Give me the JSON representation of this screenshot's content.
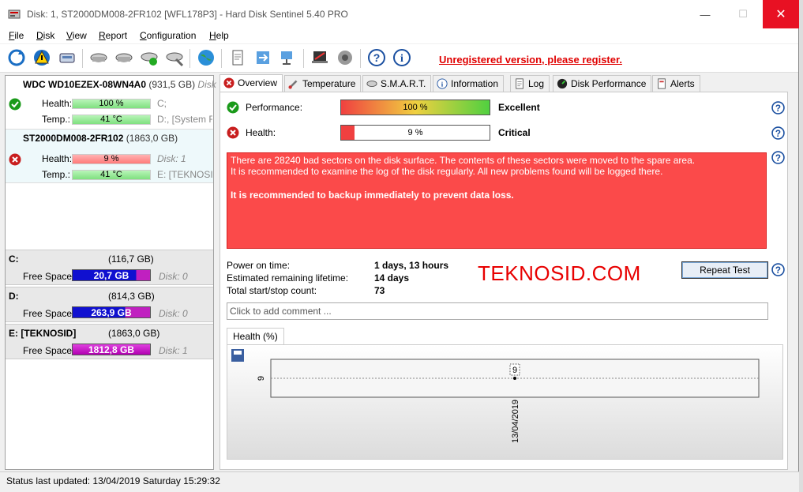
{
  "titlebar": {
    "title": "Disk: 1, ST2000DM008-2FR102 [WFL178P3]  -  Hard Disk Sentinel 5.40 PRO",
    "minimize": "—",
    "maximize": "☐",
    "close": "✕"
  },
  "menu": [
    "File",
    "Disk",
    "View",
    "Report",
    "Configuration",
    "Help"
  ],
  "toolbar": {
    "unregistered": "Unregistered version, please register."
  },
  "disks": [
    {
      "name": "WDC WD10EZEX-08WN4A0",
      "size": "(931,5 GB)",
      "extra": "Disk",
      "health_label": "Health:",
      "health": "100 %",
      "health_drives": "C;",
      "temp_label": "Temp.:",
      "temp": "41 °C",
      "temp_drives": "D:, [System R"
    },
    {
      "name": "ST2000DM008-2FR102",
      "size": "(1863,0 GB)",
      "health_label": "Health:",
      "health": "9 %",
      "health_drives": "Disk: 1",
      "temp_label": "Temp.:",
      "temp": "41 °C",
      "temp_drives": "E: [TEKNOSID"
    }
  ],
  "volumes": [
    {
      "name": "C:",
      "size": "(116,7 GB)",
      "free_label": "Free Space",
      "free": "20,7 GB",
      "disk": "Disk: 0",
      "color": "#1010d0",
      "free_fraction": 0.18
    },
    {
      "name": "D:",
      "size": "(814,3 GB)",
      "free_label": "Free Space",
      "free": "263,9 GB",
      "disk": "Disk: 0",
      "color": "#1010d0",
      "free_fraction": 0.32
    },
    {
      "name": "E: [TEKNOSID]",
      "size": "(1863,0 GB)",
      "free_label": "Free Space",
      "free": "1812,8 GB",
      "disk": "Disk: 1",
      "color": "#d000c8",
      "free_fraction": 0.97
    }
  ],
  "tabs": [
    "Overview",
    "Temperature",
    "S.M.A.R.T.",
    "Information",
    "Log",
    "Disk Performance",
    "Alerts"
  ],
  "overview": {
    "performance_label": "Performance:",
    "performance_value": "100 %",
    "performance_fraction": 1.0,
    "performance_status": "Excellent",
    "health_label": "Health:",
    "health_value": "9 %",
    "health_fraction": 0.09,
    "health_status": "Critical",
    "alert_line1": "There are 28240 bad sectors on the disk surface. The contents of these sectors were moved to the spare area.",
    "alert_line2": "It is recommended to examine the log of the disk regularly. All new problems found will be logged there.",
    "alert_line3": "It is recommended to backup immediately to prevent data loss.",
    "power_on_label": "Power on time:",
    "power_on_value": "1 days, 13 hours",
    "lifetime_label": "Estimated remaining lifetime:",
    "lifetime_value": "14 days",
    "startstop_label": "Total start/stop count:",
    "startstop_value": "73",
    "watermark": "TEKNOSID.COM",
    "repeat_button": "Repeat Test",
    "comment_placeholder": "Click to add comment ..."
  },
  "chart_tab": "Health (%)",
  "chart_data": {
    "type": "line",
    "x": [
      "13/04/2019"
    ],
    "values": [
      9
    ],
    "ytick": "9",
    "data_label": "9"
  },
  "status": {
    "text": "Status last updated: 13/04/2019 Saturday 15:29:32"
  }
}
